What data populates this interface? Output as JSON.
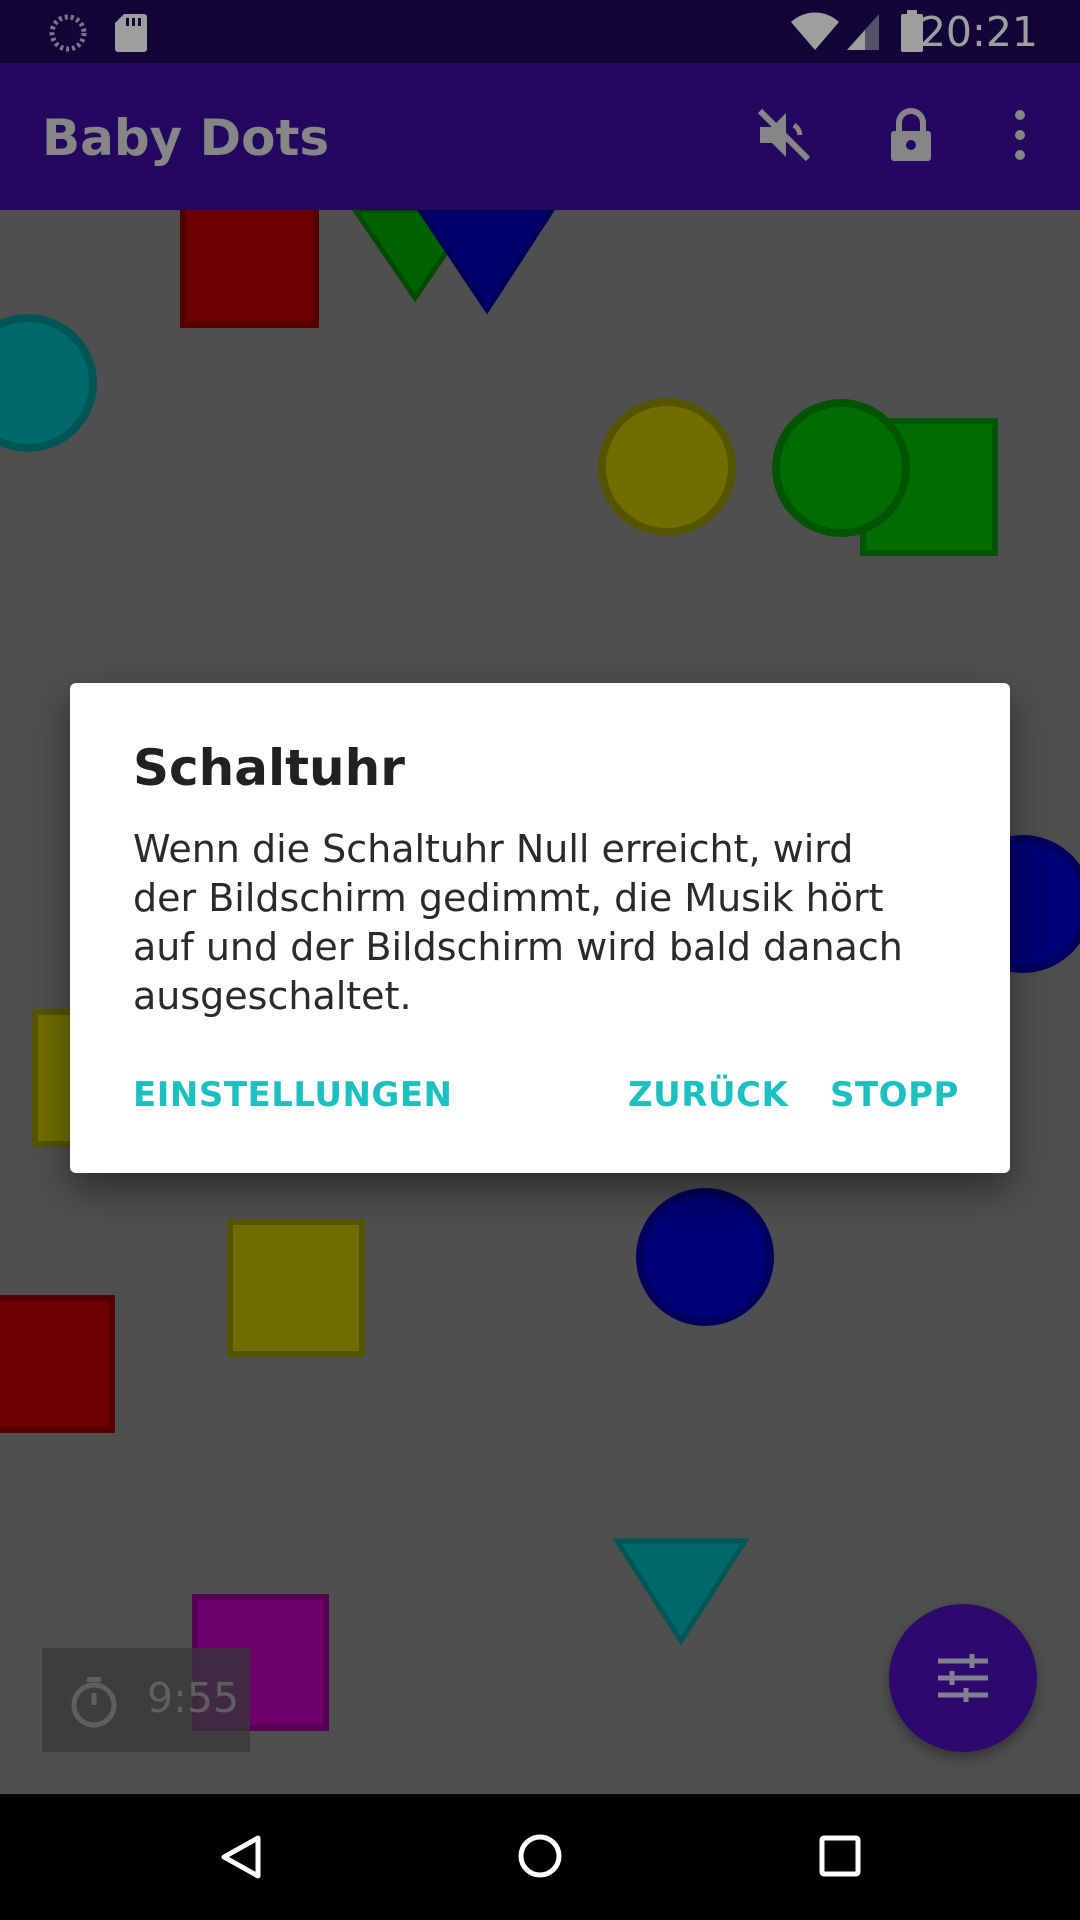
{
  "status_bar": {
    "time": "20:21"
  },
  "app_bar": {
    "title": "Baby Dots"
  },
  "timer": {
    "value": "9:55"
  },
  "dialog": {
    "title": "Schaltuhr",
    "message": "Wenn die Schaltuhr Null erreicht, wird der Bildschirm gedimmt, die Musik hört auf und der Bildschirm wird bald danach ausgeschaltet.",
    "buttons": {
      "settings": "EINSTELLUNGEN",
      "back": "ZURÜCK",
      "stop": "STOPP"
    }
  },
  "colors": {
    "status_bar": "#1d0a5c",
    "app_bar": "#3a0c9a",
    "canvas": "#808080",
    "accent": "#1cc0c0",
    "fab": "#4a10b0"
  },
  "icons": {
    "status_bar": [
      "sync-icon",
      "sd-card-icon",
      "wifi-icon",
      "cell-signal-icon",
      "battery-icon"
    ],
    "app_bar": [
      "volume-off-icon",
      "lock-icon",
      "more-vert-icon"
    ],
    "fab": "tune-icon",
    "timer": "timer-icon",
    "nav_bar": [
      "back-icon",
      "home-icon",
      "recents-icon"
    ]
  }
}
